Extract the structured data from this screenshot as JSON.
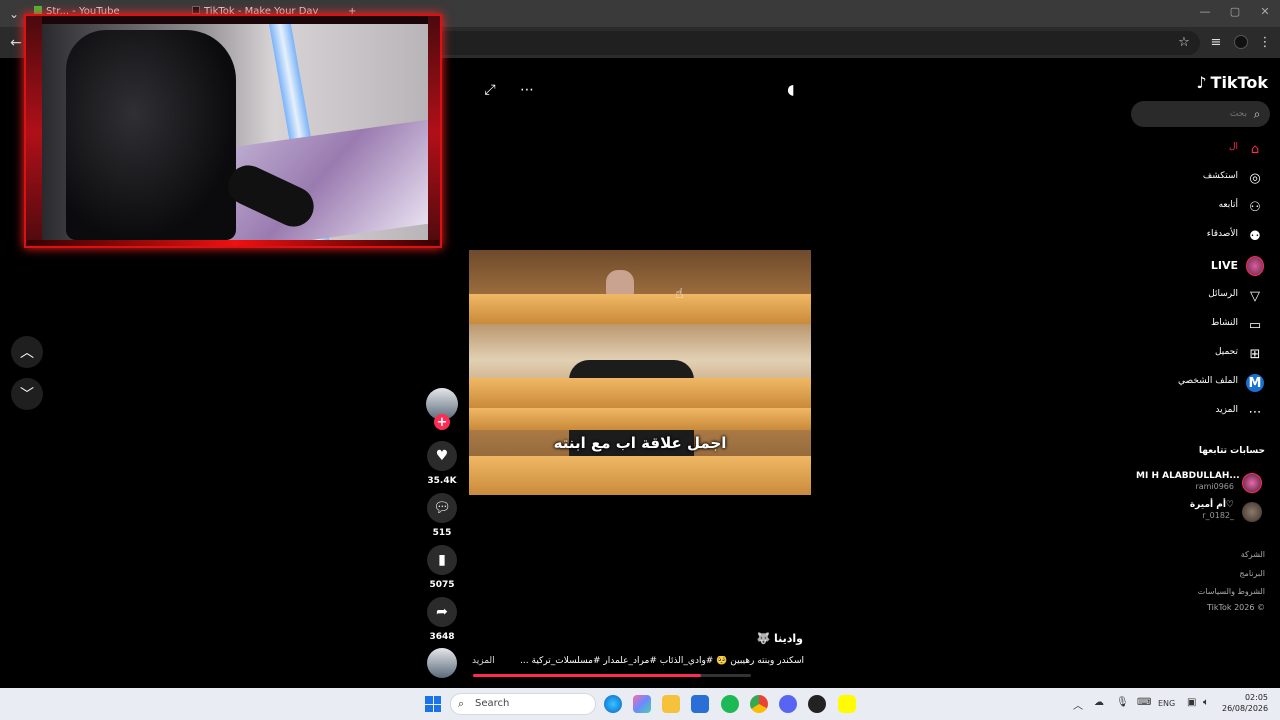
{
  "browser": {
    "tabs": [
      {
        "label": "Str... - YouTube",
        "icon_color": "#3fbf3f"
      },
      {
        "label": "TikTok - Make Your Day",
        "icon_color": "#000000"
      }
    ],
    "new_tab": "+"
  },
  "tiktok": {
    "logo_text": "TikTok",
    "search_placeholder": "بحث",
    "nav": [
      {
        "key": "home",
        "label": "ال",
        "icon": "home-icon",
        "glyph": "⌂",
        "active": true
      },
      {
        "key": "explore",
        "label": "استكشف",
        "icon": "compass-icon",
        "glyph": "◎"
      },
      {
        "key": "following",
        "label": "أتابعه",
        "icon": "person-add-icon",
        "glyph": "⚇"
      },
      {
        "key": "friends",
        "label": "الأصدقاء",
        "icon": "friends-icon",
        "glyph": "⚉"
      },
      {
        "key": "live",
        "label": "LIVE",
        "icon": "live-avatar-icon",
        "glyph": ""
      },
      {
        "key": "messages",
        "label": "الرسائل",
        "icon": "send-icon",
        "glyph": "▽"
      },
      {
        "key": "activity",
        "label": "النشاط",
        "icon": "message-box-icon",
        "glyph": "▭"
      },
      {
        "key": "upload",
        "label": "تحميل",
        "icon": "plus-square-icon",
        "glyph": "⊞"
      },
      {
        "key": "profile",
        "label": "الملف الشخصي",
        "icon": "profile-badge-icon",
        "glyph": "M"
      },
      {
        "key": "more",
        "label": "المزيد",
        "icon": "more-dots-icon",
        "glyph": "⋯"
      }
    ],
    "following_title": "حسابات تتابعها",
    "following_accounts": [
      {
        "name": "MI H ALABDULLAH...",
        "user": "rami0966"
      },
      {
        "name": "أم أميرة♡",
        "user": "r_0182_"
      }
    ],
    "footer": [
      "الشركة",
      "البرنامج",
      "الشروط والسياسات",
      "TikTok 2026 ©"
    ],
    "brand_color": "#fe2c55"
  },
  "video": {
    "subtitle": "اجمل علاقة اب مع ابنته",
    "author": "وادينا 🐺",
    "caption": "اسكندر وبنته رهيبين 🥺 #وادي_الذئاب #مراد_علمدار #مسلسلات_تركية ...",
    "more_label": "المزيد",
    "progress": 0.82,
    "follow_plus": "+",
    "likes": "35.4K",
    "comments": "515",
    "saves": "5075",
    "shares": "3648"
  },
  "taskbar": {
    "search_label": "Search",
    "language": "ENG",
    "time": "02:05",
    "date": "26/08/2026"
  }
}
